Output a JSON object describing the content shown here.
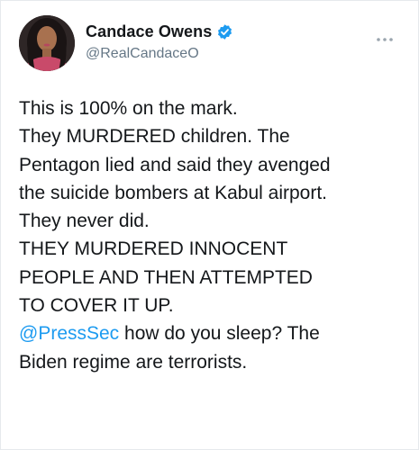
{
  "colors": {
    "verified_badge": "#1d9bf0",
    "mention_link": "#1d9bf0",
    "handle_text": "#657786",
    "body_text": "#14171a"
  },
  "author": {
    "display_name": "Candace Owens",
    "handle": "@RealCandaceO",
    "verified": true,
    "avatar_icon": "profile-photo",
    "more_icon": "more-horizontal-icon"
  },
  "tweet": {
    "lines": [
      "This is 100% on the mark.",
      "They MURDERED children. The",
      "Pentagon lied and said they avenged",
      "the suicide bombers at Kabul airport.",
      "They never did.",
      "THEY MURDERED INNOCENT",
      "PEOPLE AND THEN ATTEMPTED",
      "TO COVER IT UP."
    ],
    "mention": "@PressSec",
    "mention_rest": " how do you sleep? The",
    "last_line": "Biden regime are terrorists."
  }
}
